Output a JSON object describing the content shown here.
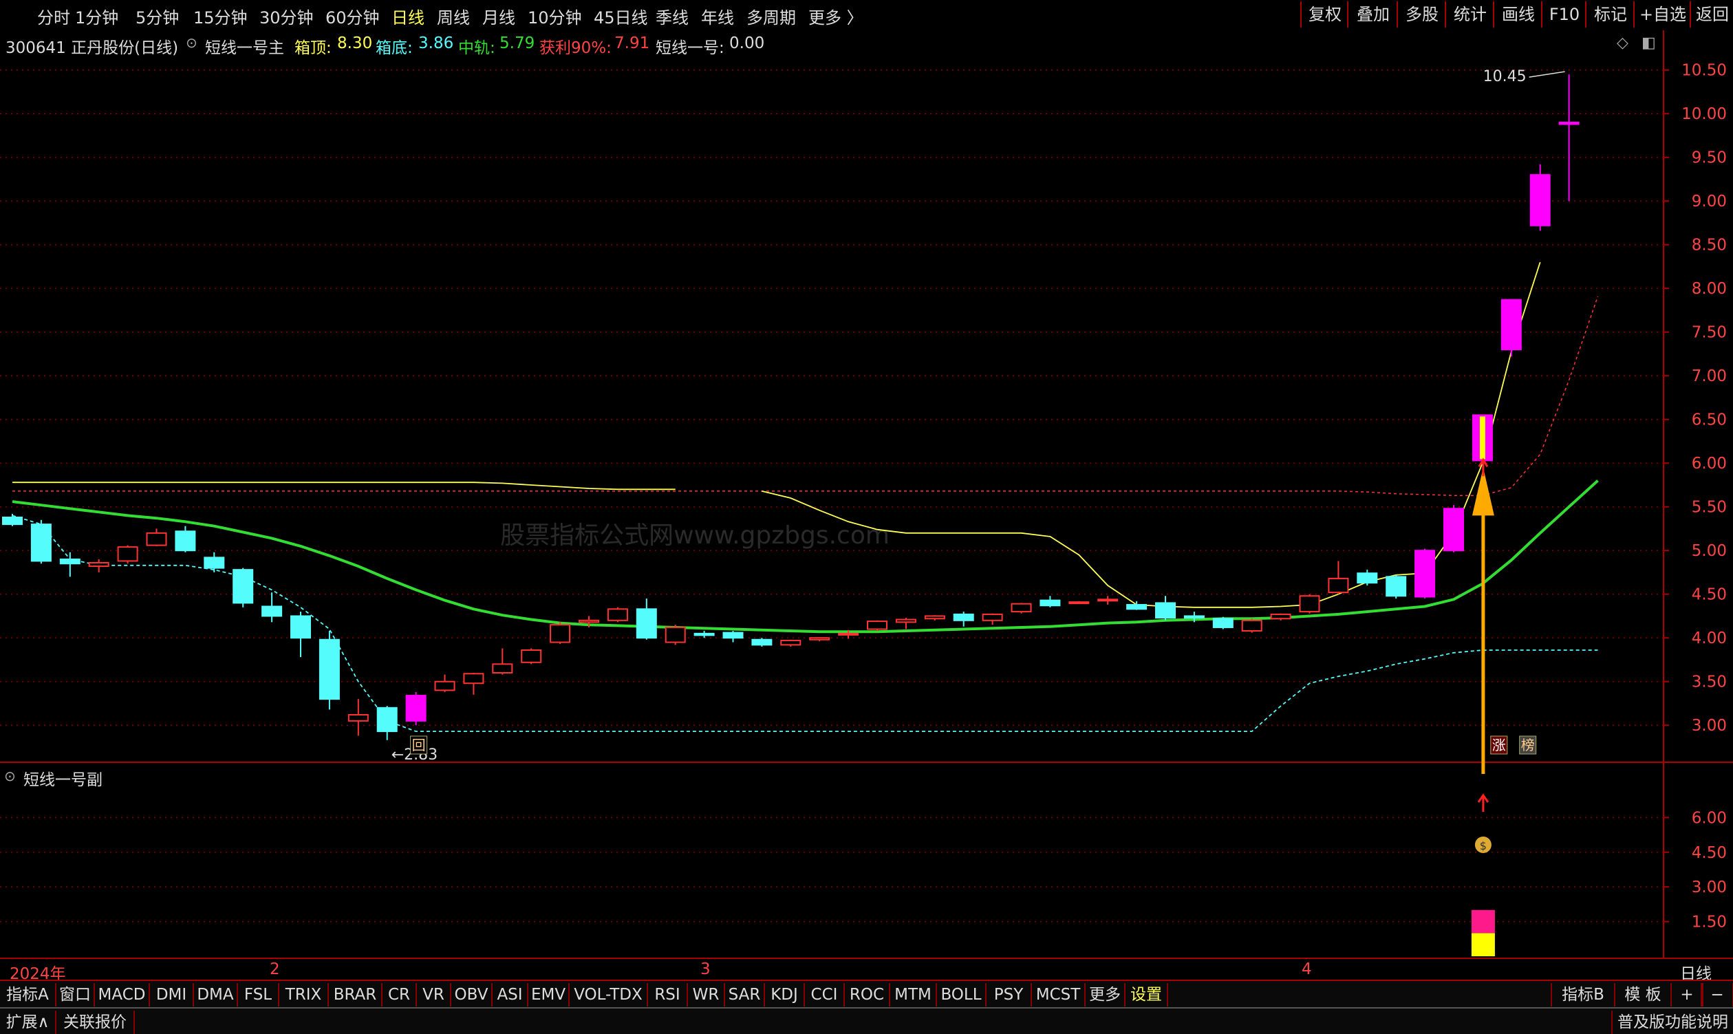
{
  "toolbar": {
    "periods": [
      "分时",
      "1分钟",
      "5分钟",
      "15分钟",
      "30分钟",
      "60分钟",
      "日线",
      "周线",
      "月线",
      "10分钟",
      "45日线",
      "季线",
      "年线",
      "多周期",
      "更多 〉"
    ],
    "active_period": "日线",
    "right_buttons": [
      "复权",
      "叠加",
      "多股",
      "统计",
      "画线",
      "F10",
      "标记",
      "+自选",
      "返回"
    ]
  },
  "info": {
    "stock": "300641 正丹股份(日线)",
    "indicator": "短线一号主",
    "box_top_label": "箱顶:",
    "box_top_value": "8.30",
    "box_bottom_label": "箱底:",
    "box_bottom_value": "3.86",
    "mid_label": "中轨:",
    "mid_value": "5.79",
    "profit_label": "获利90%:",
    "profit_value": "7.91",
    "short_label": "短线一号:",
    "short_value": "0.00"
  },
  "sub_panel": {
    "title": "短线一号副"
  },
  "dates": {
    "year": "2024年",
    "m2": "2",
    "m3": "3",
    "m4": "4",
    "period": "日线"
  },
  "watermark": "股票指标公式网www.gpzbgs.com",
  "indicator_tabs": [
    "指标A",
    "窗口",
    "MACD",
    "DMI",
    "DMA",
    "FSL",
    "TRIX",
    "BRAR",
    "CR",
    "VR",
    "OBV",
    "ASI",
    "EMV",
    "VOL-TDX",
    "RSI",
    "WR",
    "SAR",
    "KDJ",
    "CCI",
    "ROC",
    "MTM",
    "BOLL",
    "PSY",
    "MCST",
    "更多",
    "设置"
  ],
  "indicator_b": "指标B",
  "template_label": "模 板",
  "plus": "+",
  "minus": "−",
  "bottom": {
    "expand": "扩展∧",
    "related": "关联报价",
    "right": "普及版功能说明"
  },
  "colors": {
    "up": "#ff3333",
    "down": "#54fcfc",
    "magenta": "#ff00ff",
    "ma": "#33dd33",
    "upper": "#ffff55",
    "grid": "#880000",
    "arrow": "#ffaa00"
  },
  "chart_data": [
    {
      "type": "candlestick",
      "ylim": [
        2.6,
        10.75
      ],
      "yticks": [
        3.0,
        3.5,
        4.0,
        4.5,
        5.0,
        5.5,
        6.0,
        6.5,
        7.0,
        7.5,
        8.0,
        8.5,
        9.0,
        9.5,
        10.0,
        10.5
      ],
      "annotations": {
        "high": "10.45",
        "low": "2.83"
      },
      "tags": {
        "limit_up": "涨",
        "board": "榜",
        "flag": "回"
      },
      "candles": [
        {
          "o": 5.38,
          "h": 5.42,
          "l": 5.28,
          "c": 5.3
        },
        {
          "o": 5.3,
          "h": 5.35,
          "l": 4.85,
          "c": 4.88
        },
        {
          "o": 4.9,
          "h": 4.98,
          "l": 4.7,
          "c": 4.85
        },
        {
          "o": 4.82,
          "h": 4.9,
          "l": 4.75,
          "c": 4.86
        },
        {
          "o": 4.88,
          "h": 5.06,
          "l": 4.85,
          "c": 5.04
        },
        {
          "o": 5.06,
          "h": 5.25,
          "l": 5.05,
          "c": 5.2
        },
        {
          "o": 5.22,
          "h": 5.28,
          "l": 4.98,
          "c": 5.0
        },
        {
          "o": 4.92,
          "h": 4.98,
          "l": 4.75,
          "c": 4.8
        },
        {
          "o": 4.78,
          "h": 4.8,
          "l": 4.35,
          "c": 4.4
        },
        {
          "o": 4.36,
          "h": 4.52,
          "l": 4.18,
          "c": 4.25
        },
        {
          "o": 4.25,
          "h": 4.3,
          "l": 3.78,
          "c": 4.0
        },
        {
          "o": 3.98,
          "h": 4.08,
          "l": 3.18,
          "c": 3.3
        },
        {
          "o": 3.05,
          "h": 3.3,
          "l": 2.88,
          "c": 3.12
        },
        {
          "o": 3.2,
          "h": 3.22,
          "l": 2.83,
          "c": 2.93
        },
        {
          "o": 3.05,
          "h": 3.38,
          "l": 3.0,
          "c": 3.34,
          "m": true
        },
        {
          "o": 3.4,
          "h": 3.58,
          "l": 3.38,
          "c": 3.5
        },
        {
          "o": 3.48,
          "h": 3.6,
          "l": 3.35,
          "c": 3.59
        },
        {
          "o": 3.6,
          "h": 3.88,
          "l": 3.58,
          "c": 3.7
        },
        {
          "o": 3.72,
          "h": 3.88,
          "l": 3.7,
          "c": 3.86
        },
        {
          "o": 3.95,
          "h": 4.18,
          "l": 3.93,
          "c": 4.15
        },
        {
          "o": 4.18,
          "h": 4.25,
          "l": 4.12,
          "c": 4.2
        },
        {
          "o": 4.2,
          "h": 4.35,
          "l": 4.18,
          "c": 4.33
        },
        {
          "o": 4.33,
          "h": 4.45,
          "l": 3.98,
          "c": 4.0
        },
        {
          "o": 3.95,
          "h": 4.15,
          "l": 3.92,
          "c": 4.12
        },
        {
          "o": 4.05,
          "h": 4.08,
          "l": 4.0,
          "c": 4.03
        },
        {
          "o": 4.06,
          "h": 4.08,
          "l": 3.95,
          "c": 4.0
        },
        {
          "o": 3.98,
          "h": 4.0,
          "l": 3.9,
          "c": 3.92
        },
        {
          "o": 3.92,
          "h": 3.98,
          "l": 3.9,
          "c": 3.97
        },
        {
          "o": 3.98,
          "h": 4.0,
          "l": 3.96,
          "c": 4.0
        },
        {
          "o": 4.04,
          "h": 4.09,
          "l": 3.99,
          "c": 4.05
        },
        {
          "o": 4.1,
          "h": 4.2,
          "l": 4.08,
          "c": 4.19
        },
        {
          "o": 4.18,
          "h": 4.23,
          "l": 4.1,
          "c": 4.21
        },
        {
          "o": 4.22,
          "h": 4.26,
          "l": 4.2,
          "c": 4.25
        },
        {
          "o": 4.27,
          "h": 4.3,
          "l": 4.13,
          "c": 4.2
        },
        {
          "o": 4.2,
          "h": 4.28,
          "l": 4.15,
          "c": 4.27
        },
        {
          "o": 4.3,
          "h": 4.4,
          "l": 4.28,
          "c": 4.39
        },
        {
          "o": 4.43,
          "h": 4.48,
          "l": 4.35,
          "c": 4.37
        },
        {
          "o": 4.4,
          "h": 4.42,
          "l": 4.39,
          "c": 4.41
        },
        {
          "o": 4.43,
          "h": 4.48,
          "l": 4.38,
          "c": 4.44
        },
        {
          "o": 4.38,
          "h": 4.42,
          "l": 4.32,
          "c": 4.33
        },
        {
          "o": 4.4,
          "h": 4.48,
          "l": 4.2,
          "c": 4.23
        },
        {
          "o": 4.25,
          "h": 4.3,
          "l": 4.18,
          "c": 4.23
        },
        {
          "o": 4.22,
          "h": 4.24,
          "l": 4.1,
          "c": 4.12
        },
        {
          "o": 4.08,
          "h": 4.22,
          "l": 4.06,
          "c": 4.2
        },
        {
          "o": 4.22,
          "h": 4.28,
          "l": 4.2,
          "c": 4.27
        },
        {
          "o": 4.3,
          "h": 4.5,
          "l": 4.28,
          "c": 4.48
        },
        {
          "o": 4.52,
          "h": 4.88,
          "l": 4.5,
          "c": 4.68
        },
        {
          "o": 4.74,
          "h": 4.78,
          "l": 4.6,
          "c": 4.63
        },
        {
          "o": 4.7,
          "h": 4.72,
          "l": 4.45,
          "c": 4.48
        },
        {
          "o": 4.47,
          "h": 5.02,
          "l": 4.45,
          "c": 5.0,
          "m": true
        },
        {
          "o": 5.0,
          "h": 5.52,
          "l": 4.98,
          "c": 5.48,
          "m": true
        },
        {
          "o": 6.03,
          "h": 6.55,
          "l": 6.03,
          "c": 6.55,
          "m": true,
          "y": true
        },
        {
          "o": 7.3,
          "h": 7.87,
          "l": 7.22,
          "c": 7.87,
          "m": true
        },
        {
          "o": 8.72,
          "h": 9.42,
          "l": 8.66,
          "c": 9.3,
          "m": true
        },
        {
          "o": 9.9,
          "h": 10.45,
          "l": 9.0,
          "c": 9.88,
          "m": true
        }
      ],
      "ma": [
        5.56,
        5.52,
        5.48,
        5.44,
        5.4,
        5.37,
        5.33,
        5.28,
        5.21,
        5.14,
        5.05,
        4.94,
        4.82,
        4.68,
        4.55,
        4.43,
        4.33,
        4.26,
        4.21,
        4.17,
        4.15,
        4.14,
        4.13,
        4.12,
        4.11,
        4.1,
        4.09,
        4.08,
        4.07,
        4.07,
        4.07,
        4.08,
        4.09,
        4.1,
        4.11,
        4.12,
        4.13,
        4.15,
        4.17,
        4.18,
        4.2,
        4.21,
        4.22,
        4.22,
        4.23,
        4.25,
        4.27,
        4.3,
        4.33,
        4.36,
        4.44,
        4.62,
        4.89,
        5.2,
        5.5,
        5.8
      ],
      "upper": [
        5.78,
        5.78,
        5.78,
        5.78,
        5.78,
        5.78,
        5.78,
        5.78,
        5.78,
        5.78,
        5.78,
        5.78,
        5.78,
        5.78,
        5.78,
        5.78,
        5.78,
        5.77,
        5.75,
        5.73,
        5.71,
        5.7,
        5.7,
        5.7,
        null,
        null,
        5.68,
        5.6,
        5.46,
        5.33,
        5.24,
        5.2,
        5.2,
        5.2,
        5.2,
        5.2,
        5.16,
        4.95,
        4.6,
        4.38,
        4.36,
        4.35,
        4.35,
        4.35,
        4.36,
        4.38,
        4.5,
        4.64,
        4.72,
        4.74,
        5.2,
        6.0,
        7.28,
        8.3
      ],
      "lower": [
        5.4,
        5.3,
        4.9,
        4.83,
        4.83,
        4.83,
        4.83,
        4.78,
        4.7,
        4.55,
        4.35,
        4.1,
        3.5,
        3.05,
        2.93,
        2.93,
        2.93,
        2.93,
        2.93,
        2.93,
        2.93,
        2.93,
        2.93,
        2.93,
        2.93,
        2.93,
        2.93,
        2.93,
        2.93,
        2.93,
        2.93,
        2.93,
        2.93,
        2.93,
        2.93,
        2.93,
        2.93,
        2.93,
        2.93,
        2.93,
        2.93,
        2.93,
        2.93,
        2.93,
        3.22,
        3.48,
        3.56,
        3.62,
        3.7,
        3.76,
        3.83,
        3.86,
        3.86,
        3.86,
        3.86,
        3.86
      ],
      "red_dashed": [
        5.68,
        5.68,
        5.68,
        5.68,
        5.68,
        5.68,
        5.68,
        5.68,
        5.68,
        5.68,
        5.68,
        5.68,
        5.68,
        5.68,
        5.68,
        5.68,
        5.68,
        5.68,
        5.68,
        5.68,
        5.68,
        5.68,
        5.68,
        5.68,
        5.68,
        5.68,
        5.68,
        5.68,
        5.68,
        5.68,
        5.68,
        5.68,
        5.68,
        5.68,
        5.68,
        5.68,
        5.68,
        5.68,
        5.68,
        5.68,
        5.68,
        5.68,
        5.68,
        5.68,
        5.68,
        5.68,
        5.68,
        5.67,
        5.65,
        5.64,
        5.63,
        5.63,
        5.72,
        6.1,
        6.95,
        7.91
      ]
    },
    {
      "type": "bar",
      "ylim": [
        0,
        7.2
      ],
      "yticks": [
        1.5,
        3.0,
        4.5,
        6.0
      ],
      "bar_index": 51,
      "segments": [
        {
          "from": 0,
          "to": 1.0,
          "color": "#ffff00"
        },
        {
          "from": 1.0,
          "to": 2.0,
          "color": "#ff1a8c"
        }
      ]
    }
  ]
}
